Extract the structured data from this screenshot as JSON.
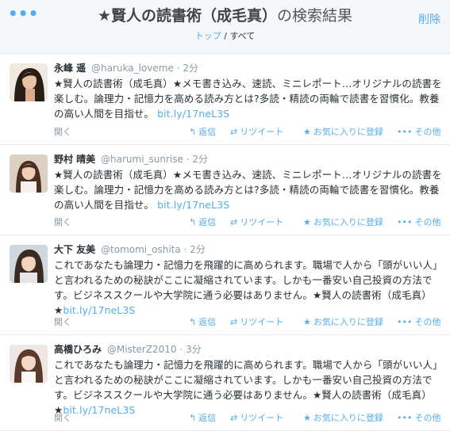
{
  "header": {
    "more_icon": "•••",
    "title_main": "★賢人の読書術（成毛真）",
    "title_suffix": "の検索結果",
    "delete_label": "削除"
  },
  "breadcrumb": {
    "home": "トップ",
    "sep": " / ",
    "current": "すべて"
  },
  "actions": {
    "open": "開く",
    "reply": "返信",
    "retweet": "リツイート",
    "favorite": "お気に入りに登録",
    "more": "その他"
  },
  "tweets": [
    {
      "name": "永峰 遥",
      "screen_name": "@haruka_loveme",
      "time": "2分",
      "text": "★賢人の読書術（成毛真）★メモ書き込み、速読、ミニレポート…オリジナルの読書を楽しむ。論理力・記憶力を高める読み方とは?多読・精読の両輪で読書を習慣化。教養の高い人間を目指せ。",
      "link": "bit.ly/17neL3S"
    },
    {
      "name": "野村 晴美",
      "screen_name": "@harumi_sunrise",
      "time": "2分",
      "text": "★賢人の読書術（成毛真）★メモ書き込み、速読、ミニレポート…オリジナルの読書を楽しむ。論理力・記憶力を高める読み方とは?多読・精読の両輪で読書を習慣化。教養の高い人間を目指せ。",
      "link": "bit.ly/17neL3S"
    },
    {
      "name": "大下 友美",
      "screen_name": "@tomomi_oshita",
      "time": "2分",
      "text": "これであなたも論理力・記憶力を飛躍的に高められます。職場で人から「頭がいい人」と言われるための秘訣がここに凝縮されています。しかも一番安い自己投資の方法です。ビジネススクールや大学院に通う必要はありません。★賢人の読書術（成毛真）★",
      "link": "bit.ly/17neL3S"
    },
    {
      "name": "高橋ひろみ",
      "screen_name": "@MisterZ2010",
      "time": "3分",
      "text": "これであなたも論理力・記憶力を飛躍的に高められます。職場で人から「頭がいい人」と言われるための秘訣がここに凝縮されています。しかも一番安い自己投資の方法です。ビジネススクールや大学院に通う必要はありません。★賢人の読書術（成毛真）★",
      "link": "bit.ly/17neL3S"
    }
  ],
  "icons": {
    "reply": "reply-icon",
    "retweet": "retweet-icon",
    "favorite": "star-icon",
    "more": "more-dots-icon"
  },
  "colors": {
    "accent": "#55acee",
    "meta": "#8899a6",
    "text": "#292f33"
  }
}
